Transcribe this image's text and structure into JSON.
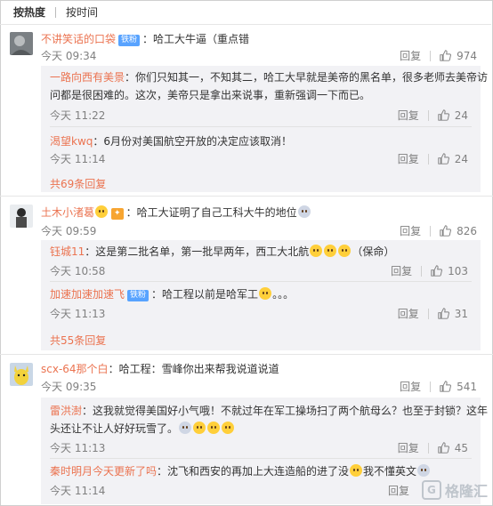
{
  "tabs": [
    {
      "label": "按热度"
    },
    {
      "label": "按时间"
    }
  ],
  "comments": [
    {
      "name": "不讲笑话的口袋",
      "badge": "铁粉",
      "text": "哈工大牛逼（重点错",
      "time": "今天 09:34",
      "reply": "回复",
      "likes": "974",
      "replies": [
        {
          "name": "一路向西有美景",
          "text": "你们只知其一，不知其二，哈工大早就是美帝的黑名单，很多老师去美帝访",
          "text2": "问都是很困难的。这次，美帝只是拿出来说事，重新强调一下而已。",
          "time": "今天 11:22",
          "reply": "回复",
          "likes": "24"
        },
        {
          "name": "渴望kwq",
          "text": "6月份对美国航空开放的决定应该取消！",
          "time": "今天 11:14",
          "reply": "回复",
          "likes": "24"
        }
      ],
      "more": "共69条回复"
    },
    {
      "name": "土木小渚葛",
      "badge": "",
      "text": "哈工大证明了自己工科大牛的地位",
      "time": "今天 09:59",
      "reply": "回复",
      "likes": "826",
      "replies": [
        {
          "name": "钰城11",
          "text": "这是第二批名单，第一批早两年，西工大北航",
          "text_tail": "（保命）",
          "time": "今天 10:58",
          "reply": "回复",
          "likes": "103"
        },
        {
          "name": "加速加速加速飞",
          "badge": "铁粉",
          "text": "哈工程以前是哈军工",
          "text_tail": "。。。",
          "time": "今天 11:13",
          "reply": "回复",
          "likes": "31"
        }
      ],
      "more": "共55条回复"
    },
    {
      "name": "scx-64那个白",
      "badge": "",
      "text": "哈工程：雪峰你出来帮我说道说道",
      "time": "今天 09:35",
      "reply": "回复",
      "likes": "541",
      "replies": [
        {
          "name": "雷洪澍",
          "text": "这我就觉得美国好小气哦！不就过年在军工操场扫了两个航母么？也至于封锁？这年",
          "text2": "头还让不让人好好玩雪了。",
          "time": "今天 11:13",
          "reply": "回复",
          "likes": "45"
        },
        {
          "name": "秦时明月今天更新了吗",
          "text": "沈飞和西安的再加上大连造船的进了没",
          "text_tail": "我不懂英文",
          "time": "今天 11:14",
          "reply": "回复",
          "likes": ""
        }
      ]
    }
  ],
  "watermark": "格隆汇",
  "colors": {
    "name": "#eb7350",
    "badge": "#58a3ff",
    "bg_sub": "#f2f2f5",
    "time": "#808080"
  },
  "icons": [
    "thumbs-up-icon",
    "emoji-icon",
    "avatar-image"
  ]
}
